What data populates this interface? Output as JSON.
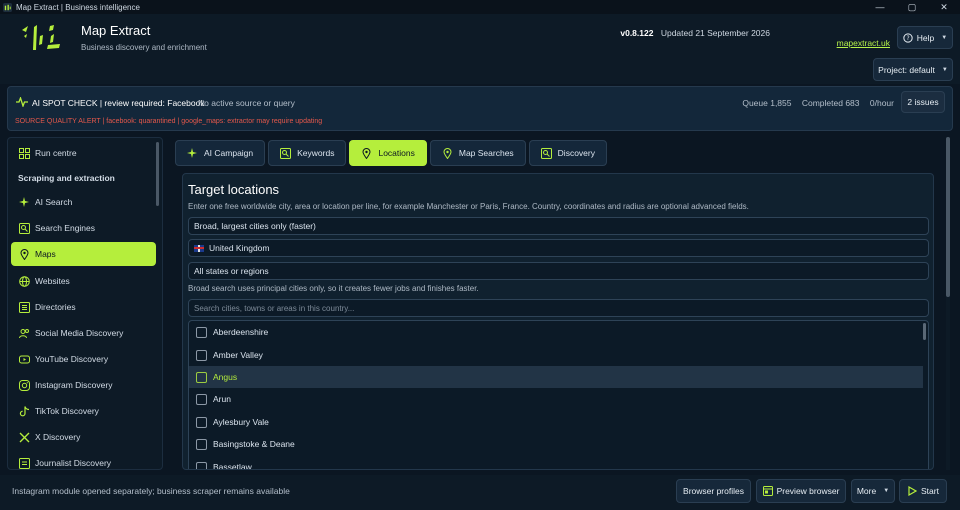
{
  "window": {
    "title": "Map Extract | Business intelligence",
    "controls": [
      "—",
      "▢",
      "✕"
    ]
  },
  "header": {
    "app_name": "Map Extract",
    "subtitle": "Business discovery and enrichment",
    "version": "v0.8.122",
    "updated": "Updated 21 September 2026",
    "site_link": "mapextract.uk",
    "help_label": "Help",
    "project_label": "Project: default"
  },
  "alert": {
    "spot_check": "AI SPOT CHECK | review required: Facebook",
    "status": "No active source or query",
    "queue": "Queue 1,855",
    "completed": "Completed 683",
    "rate": "0/hour",
    "issues_label": "2 issues",
    "source_alert": "SOURCE QUALITY ALERT | facebook: quarantined | google_maps: extractor may require updating"
  },
  "sidebar": {
    "top_item": "Run centre",
    "section_heading": "Scraping and extraction",
    "items": [
      {
        "label": "AI Search",
        "icon": "sparkle-icon"
      },
      {
        "label": "Search Engines",
        "icon": "search-engine-icon"
      },
      {
        "label": "Maps",
        "icon": "map-pin-icon",
        "active": true
      },
      {
        "label": "Websites",
        "icon": "globe-icon"
      },
      {
        "label": "Directories",
        "icon": "directory-icon"
      },
      {
        "label": "Social Media Discovery",
        "icon": "people-icon"
      },
      {
        "label": "YouTube Discovery",
        "icon": "youtube-icon"
      },
      {
        "label": "Instagram Discovery",
        "icon": "instagram-icon"
      },
      {
        "label": "TikTok Discovery",
        "icon": "tiktok-icon"
      },
      {
        "label": "X Discovery",
        "icon": "x-icon"
      },
      {
        "label": "Journalist Discovery",
        "icon": "journalist-icon"
      }
    ]
  },
  "tabs": [
    {
      "label": "AI Campaign",
      "icon": "sparkle-icon"
    },
    {
      "label": "Keywords",
      "icon": "keywords-icon"
    },
    {
      "label": "Locations",
      "icon": "map-pin-icon",
      "active": true
    },
    {
      "label": "Map Searches",
      "icon": "map-pin-icon"
    },
    {
      "label": "Discovery",
      "icon": "discovery-icon"
    }
  ],
  "locations": {
    "title": "Target locations",
    "description": "Enter one free worldwide city, area or location per line, for example Manchester or Paris, France. Country, coordinates and radius are optional advanced fields.",
    "search_mode": "Broad, largest cities only (faster)",
    "country": "United Kingdom",
    "region": "All states or regions",
    "broad_note": "Broad search uses principal cities only, so it creates fewer jobs and finishes faster.",
    "search_placeholder": "Search cities, towns or areas in this country...",
    "areas": [
      "Aberdeenshire",
      "Amber Valley",
      "Angus",
      "Arun",
      "Aylesbury Vale",
      "Basingstoke & Deane",
      "Bassetlaw"
    ],
    "highlighted_index": 2
  },
  "footer": {
    "message": "Instagram module opened separately; business scraper remains available",
    "browser_profiles": "Browser profiles",
    "preview_browser": "Preview browser",
    "more": "More",
    "start": "Start"
  },
  "colors": {
    "accent": "#b5ee3c",
    "background": "#0b1622",
    "alert_red": "#e4584b"
  }
}
